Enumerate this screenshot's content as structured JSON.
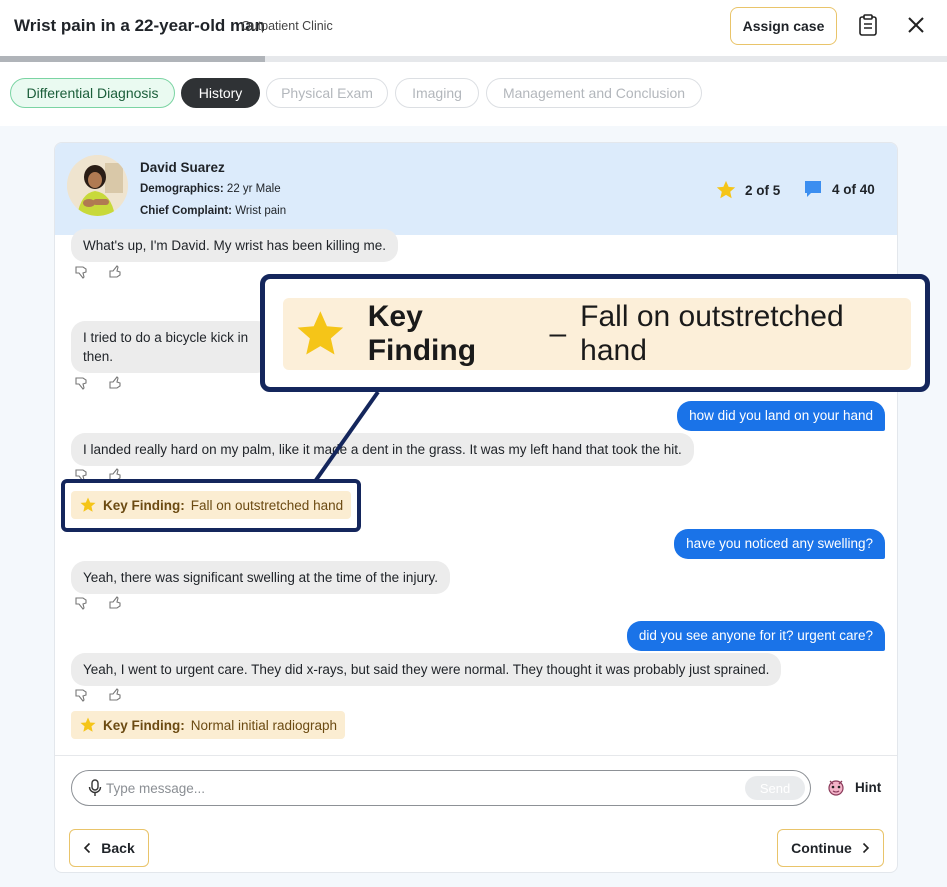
{
  "header": {
    "title": "Wrist pain in a 22-year-old man",
    "subtitle": "Outpatient Clinic",
    "assign_label": "Assign case",
    "progress_fraction": 0.28
  },
  "tabs": [
    {
      "label": "Differential Diagnosis",
      "state": "done"
    },
    {
      "label": "History",
      "state": "active"
    },
    {
      "label": "Physical Exam",
      "state": "disabled"
    },
    {
      "label": "Imaging",
      "state": "disabled"
    },
    {
      "label": "Management and Conclusion",
      "state": "disabled"
    }
  ],
  "patient": {
    "name": "David Suarez",
    "demographics_label": "Demographics:",
    "demographics_value": "22 yr Male",
    "complaint_label": "Chief Complaint:",
    "complaint_value": "Wrist pain",
    "stars": "2 of 5",
    "messages": "4 of 40"
  },
  "chat": {
    "m1": "What's up, I'm David. My wrist has been killing me.",
    "m2a": "I tried to do a bicycle kick in",
    "m2b": "then.",
    "q1": "how did you land on your hand",
    "m3": "I landed really hard on my palm, like it made a dent in the grass. It was my left hand that took the hit.",
    "kf1_label": "Key Finding:",
    "kf1_text": "Fall on outstretched hand",
    "q2": "have you noticed any swelling?",
    "m4": "Yeah, there was significant swelling at the time of the injury.",
    "q3": "did you see anyone for it? urgent care?",
    "m5": "Yeah, I went to urgent care. They did x-rays, but said they were normal. They thought it was probably just sprained.",
    "kf2_label": "Key Finding:",
    "kf2_text": "Normal initial radiograph"
  },
  "composer": {
    "placeholder": "Type message...",
    "send_label": "Send",
    "hint_label": "Hint"
  },
  "nav": {
    "back_label": "Back",
    "continue_label": "Continue"
  },
  "callout": {
    "label": "Key Finding",
    "dash": "–",
    "text": "Fall on outstretched hand"
  },
  "colors": {
    "accent_blue": "#1a73e8",
    "callout_navy": "#14265c",
    "star_gold": "#f5c518",
    "key_finding_bg": "#fbedd2",
    "button_border": "#e9c46a"
  }
}
